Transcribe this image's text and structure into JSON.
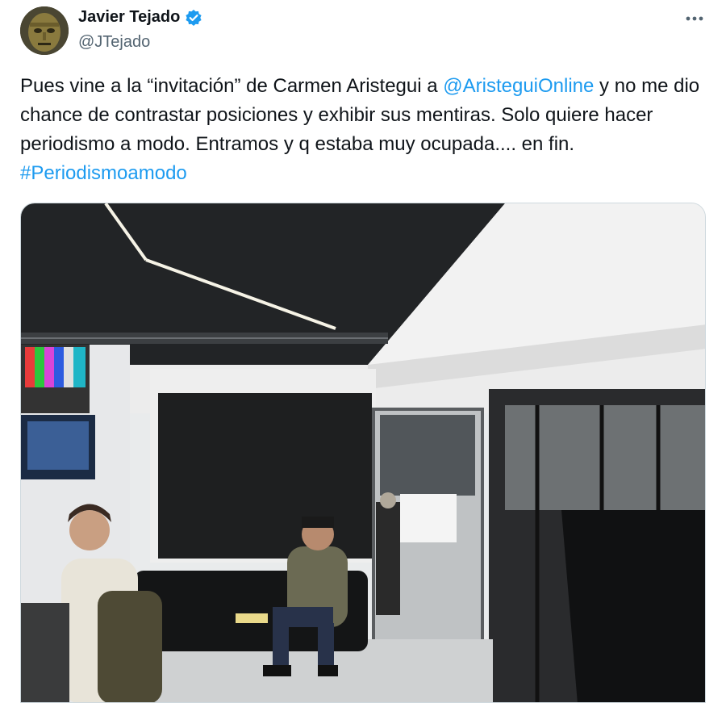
{
  "author": {
    "display_name": "Javier Tejado",
    "handle": "@JTejado",
    "verified": true,
    "avatar_icon": "mask-avatar-icon"
  },
  "tweet": {
    "segments": [
      {
        "text": "Pues vine a la “invitación” de Carmen Aristegui a ",
        "type": "text"
      },
      {
        "text": "@AristeguiOnline",
        "type": "mention"
      },
      {
        "text": " y no me dio chance de contrastar posiciones y exhibir sus mentiras. Solo quiere hacer periodismo a modo. Entramos y q estaba muy ocupada.... en fin. ",
        "type": "text"
      },
      {
        "text": "#Periodismoamodo",
        "type": "hashtag"
      }
    ]
  },
  "menu": {
    "more_icon": "more-options-icon"
  },
  "colors": {
    "link": "#1d9bf0",
    "verified": "#1d9bf0",
    "text": "#0f1419",
    "secondary": "#536471"
  }
}
